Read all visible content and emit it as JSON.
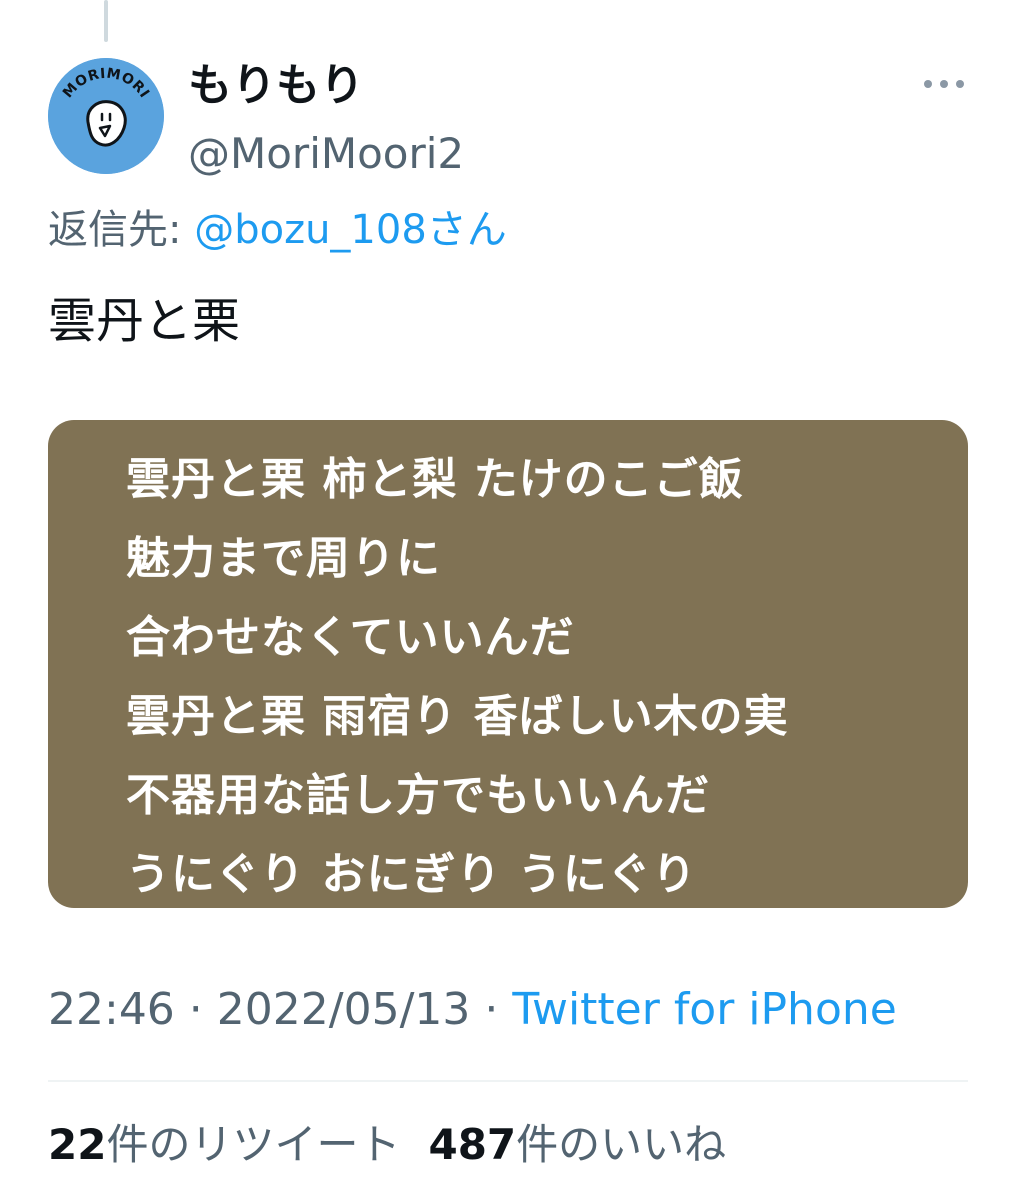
{
  "colors": {
    "accent": "#1d9bf0",
    "secondary_text": "#536471",
    "media_background": "#807254",
    "avatar_background": "#5aa3de"
  },
  "user": {
    "display_name": "もりもり",
    "handle": "@MoriMoori2",
    "avatar_text": "MORIMORI",
    "more_icon": "more-horizontal-icon"
  },
  "reply": {
    "prefix": "返信先: ",
    "mention": "@bozu_108さん"
  },
  "tweet": {
    "text": "雲丹と栗"
  },
  "media": {
    "lyrics": [
      "雲丹と栗 柿と梨 たけのこご飯",
      "魅力まで周りに",
      "合わせなくていいんだ",
      "雲丹と栗 雨宿り 香ばしい木の実",
      "不器用な話し方でもいいんだ",
      "うにぐり おにぎり うにぐり"
    ]
  },
  "meta": {
    "time": "22:46",
    "separator": " · ",
    "date": "2022/05/13",
    "source": "Twitter for iPhone"
  },
  "stats": {
    "retweets_count": "22",
    "retweets_label": "件のリツイート",
    "likes_count": "487",
    "likes_label": "件のいいね"
  }
}
